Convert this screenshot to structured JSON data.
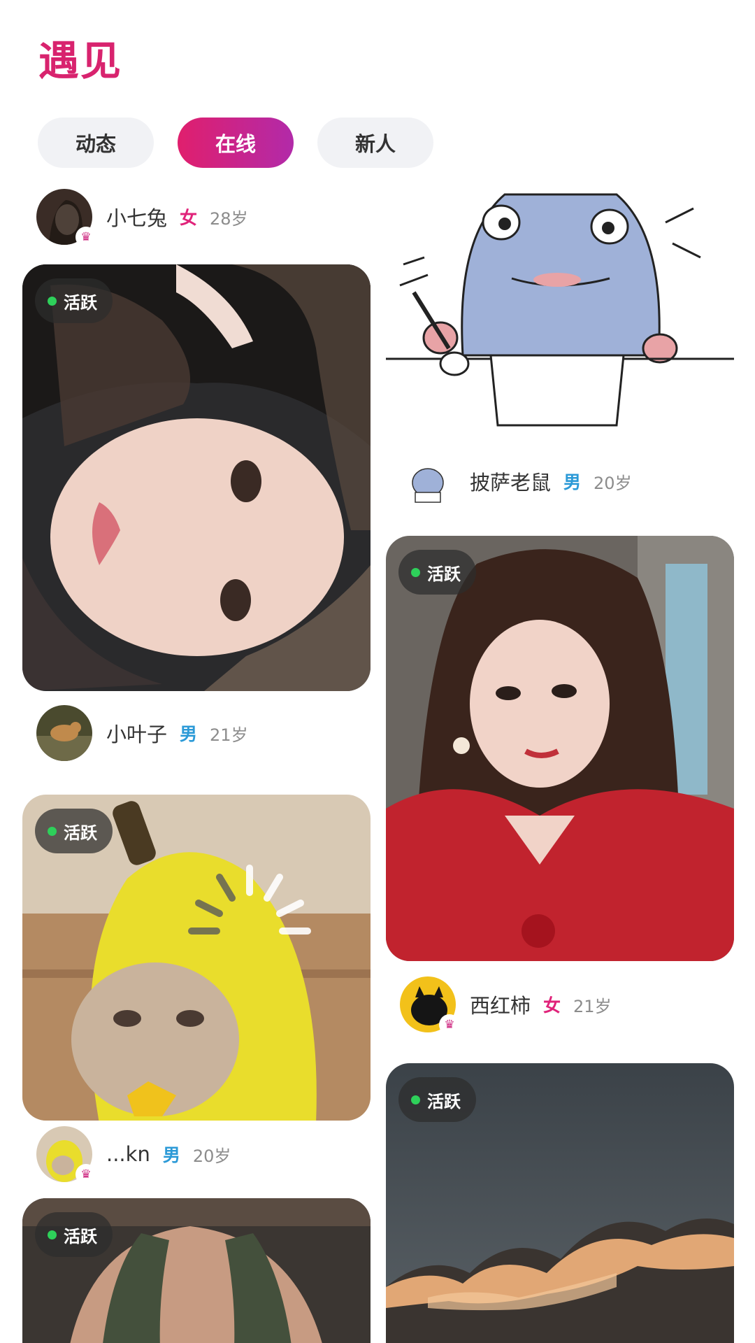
{
  "header": {
    "title": "遇见"
  },
  "tabs": [
    {
      "label": "动态"
    },
    {
      "label": "在线"
    },
    {
      "label": "新人"
    }
  ],
  "left_column": [
    {
      "user": {
        "name": "小七兔",
        "gender": "女",
        "age": "28岁",
        "vip": true
      }
    },
    {
      "status": "活跃",
      "user": {
        "name": "小叶子",
        "gender": "男",
        "age": "21岁",
        "vip": false
      }
    },
    {
      "status": "活跃",
      "user": {
        "name": "...kn",
        "gender": "男",
        "age": "20岁",
        "vip": true
      }
    },
    {
      "status": "活跃"
    }
  ],
  "right_column": [
    {
      "user": {
        "name": "披萨老鼠",
        "gender": "男",
        "age": "20岁",
        "vip": false
      }
    },
    {
      "status": "活跃",
      "user": {
        "name": "西红柿",
        "gender": "女",
        "age": "21岁",
        "vip": true
      }
    },
    {
      "status": "活跃"
    }
  ],
  "icons": {
    "vip": "crown-icon",
    "status": "online-dot-icon"
  },
  "colors": {
    "accent": "#d8236e",
    "tab_gradient_start": "#e01f6d",
    "tab_gradient_end": "#b22aa9",
    "female": "#e0237a",
    "male": "#2c9ad7",
    "active_dot": "#2ed05a"
  }
}
